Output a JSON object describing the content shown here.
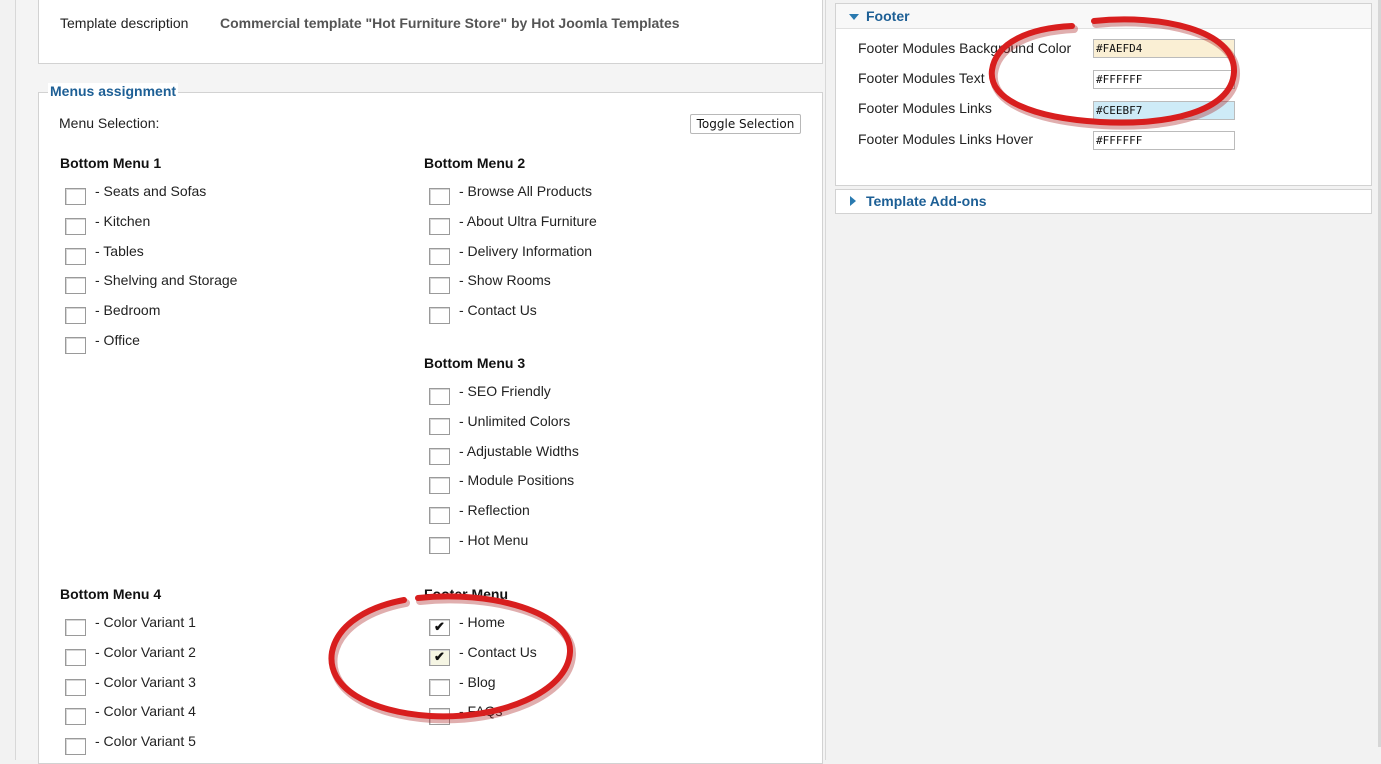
{
  "template_description": {
    "label": "Template description",
    "value": "Commercial template \"Hot Furniture Store\" by Hot Joomla Templates"
  },
  "menus_assignment": {
    "legend": "Menus assignment",
    "menu_selection_label": "Menu Selection:",
    "toggle_label": "Toggle Selection",
    "groups": [
      {
        "title": "Bottom Menu 1",
        "items": [
          {
            "label": "- Seats and Sofas",
            "checked": false
          },
          {
            "label": "- Kitchen",
            "checked": false
          },
          {
            "label": "- Tables",
            "checked": false
          },
          {
            "label": "- Shelving and Storage",
            "checked": false
          },
          {
            "label": "- Bedroom",
            "checked": false
          },
          {
            "label": "- Office",
            "checked": false
          }
        ]
      },
      {
        "title": "Bottom Menu 2",
        "items": [
          {
            "label": "- Browse All Products",
            "checked": false
          },
          {
            "label": "- About Ultra Furniture",
            "checked": false
          },
          {
            "label": "- Delivery Information",
            "checked": false
          },
          {
            "label": "- Show Rooms",
            "checked": false
          },
          {
            "label": "- Contact Us",
            "checked": false
          }
        ]
      },
      {
        "title": "Bottom Menu 3",
        "items": [
          {
            "label": "- SEO Friendly",
            "checked": false
          },
          {
            "label": "- Unlimited Colors",
            "checked": false
          },
          {
            "label": "- Adjustable Widths",
            "checked": false
          },
          {
            "label": "- Module Positions",
            "checked": false
          },
          {
            "label": "- Reflection",
            "checked": false
          },
          {
            "label": "- Hot Menu",
            "checked": false
          }
        ]
      },
      {
        "title": "Bottom Menu 4",
        "items": [
          {
            "label": "- Color Variant 1",
            "checked": false
          },
          {
            "label": "- Color Variant 2",
            "checked": false
          },
          {
            "label": "- Color Variant 3",
            "checked": false
          },
          {
            "label": "- Color Variant 4",
            "checked": false
          },
          {
            "label": "- Color Variant 5",
            "checked": false
          }
        ]
      },
      {
        "title": "Footer Menu",
        "items": [
          {
            "label": "- Home",
            "checked": true
          },
          {
            "label": "- Contact Us",
            "checked": true
          },
          {
            "label": "- Blog",
            "checked": false
          },
          {
            "label": "- FAQs",
            "checked": false
          }
        ]
      }
    ]
  },
  "footer": {
    "title": "Footer",
    "fields": [
      {
        "label": "Footer Modules Background Color",
        "value": "#FAEFD4",
        "bg": "#FAEFD4"
      },
      {
        "label": "Footer Modules Text",
        "value": "#FFFFFF",
        "bg": "#FFFFFF"
      },
      {
        "label": "Footer Modules Links",
        "value": "#CEEBF7",
        "bg": "#CEEBF7"
      },
      {
        "label": "Footer Modules Links Hover",
        "value": "#FFFFFF",
        "bg": "#FFFFFF"
      }
    ]
  },
  "template_addons": {
    "title": "Template Add-ons"
  },
  "colors": {
    "accent": "#1d5f95",
    "annotation": "#d81e1e"
  }
}
